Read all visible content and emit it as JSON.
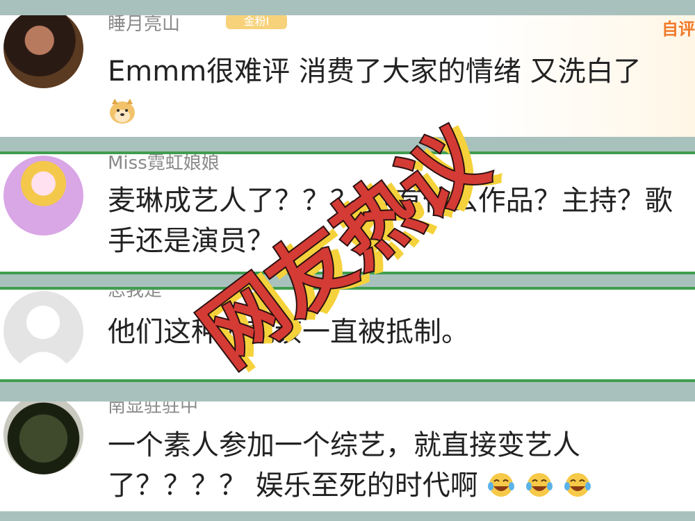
{
  "overlay_text": "网友热议",
  "colors": {
    "stamp_red": "#d43b35",
    "stamp_shadow": "#f5d23b",
    "divider_green": "#3f9e4f"
  },
  "comments": [
    {
      "username": "睡月亮山",
      "badge": "金粉I",
      "corner": "自评",
      "text": "Emmm很难评 消费了大家的情绪 又洗白了",
      "emoji": "doge-emoji"
    },
    {
      "username": "Miss霓虹娘娘",
      "text": "麦琳成艺人了？？？ 她有什么作品？主持？歌手还是演员？"
    },
    {
      "username": "恋我是",
      "text": "他们这种人就该一直被抵制。"
    },
    {
      "username": "南显驻驻中",
      "text": "一个素人参加一个综艺，就直接变艺人了？？？？ 娱乐至死的时代啊",
      "emoji_count": "3"
    }
  ]
}
